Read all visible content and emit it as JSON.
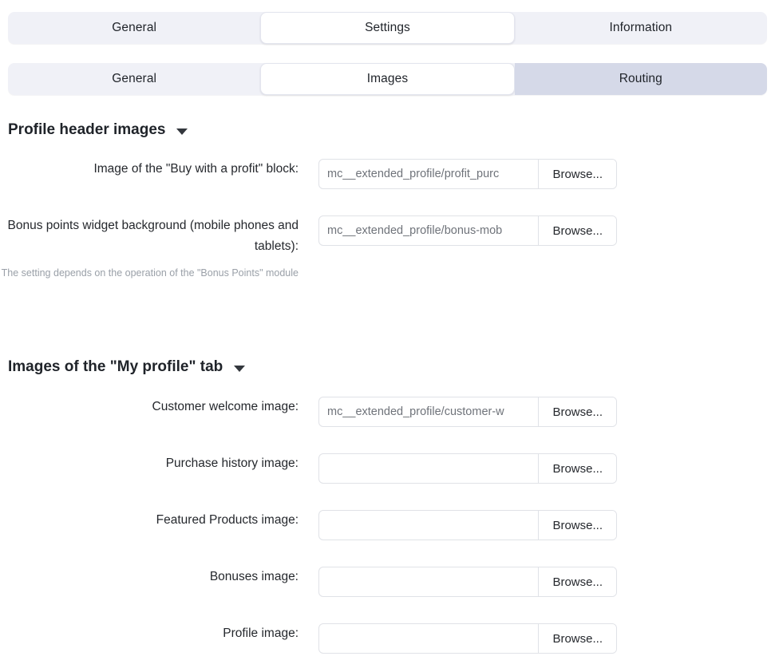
{
  "tabs_primary": {
    "items": [
      {
        "label": "General",
        "state": "inactive"
      },
      {
        "label": "Settings",
        "state": "active"
      },
      {
        "label": "Information",
        "state": "inactive"
      }
    ]
  },
  "tabs_secondary": {
    "items": [
      {
        "label": "General",
        "state": "inactive"
      },
      {
        "label": "Images",
        "state": "active"
      },
      {
        "label": "Routing",
        "state": "hover"
      }
    ]
  },
  "sections": [
    {
      "title": "Profile header images",
      "caret_icon": "caret-down-icon",
      "rows": [
        {
          "label": "Image of the \"Buy with a profit\" block:",
          "hint": "",
          "value": "mc__extended_profile/profit_purc",
          "placeholder": "",
          "browse_label": "Browse..."
        },
        {
          "label": "Bonus points widget background (mobile phones and tablets):",
          "hint": "The setting depends on the operation of the \"Bonus Points\" module",
          "value": "mc__extended_profile/bonus-mob",
          "placeholder": "",
          "browse_label": "Browse..."
        }
      ]
    },
    {
      "title": "Images of the \"My profile\" tab",
      "caret_icon": "caret-down-icon",
      "rows": [
        {
          "label": "Customer welcome image:",
          "hint": "",
          "value": "mc__extended_profile/customer-w",
          "placeholder": "",
          "browse_label": "Browse..."
        },
        {
          "label": "Purchase history image:",
          "hint": "",
          "value": "",
          "placeholder": "",
          "browse_label": "Browse..."
        },
        {
          "label": "Featured Products image:",
          "hint": "",
          "value": "",
          "placeholder": "",
          "browse_label": "Browse..."
        },
        {
          "label": "Bonuses image:",
          "hint": "",
          "value": "",
          "placeholder": "",
          "browse_label": "Browse..."
        },
        {
          "label": "Profile image:",
          "hint": "",
          "value": "",
          "placeholder": "",
          "browse_label": "Browse..."
        }
      ]
    }
  ],
  "colors": {
    "tabbar_bg": "#f0f1f7",
    "tab_active_bg": "#ffffff",
    "tab_hover_bg": "#d5d9e8",
    "field_border": "#e0e2e7",
    "text": "#25282d",
    "hint_text": "#9aa0a8"
  }
}
